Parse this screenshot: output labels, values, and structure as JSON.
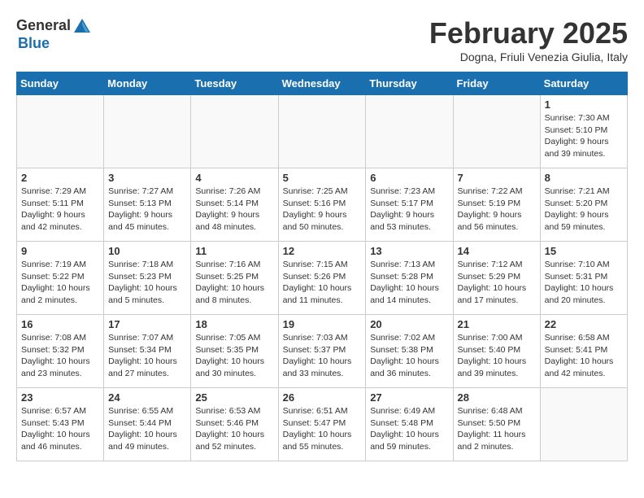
{
  "header": {
    "logo_general": "General",
    "logo_blue": "Blue",
    "title": "February 2025",
    "subtitle": "Dogna, Friuli Venezia Giulia, Italy"
  },
  "calendar": {
    "days_of_week": [
      "Sunday",
      "Monday",
      "Tuesday",
      "Wednesday",
      "Thursday",
      "Friday",
      "Saturday"
    ],
    "weeks": [
      [
        {
          "day": "",
          "info": ""
        },
        {
          "day": "",
          "info": ""
        },
        {
          "day": "",
          "info": ""
        },
        {
          "day": "",
          "info": ""
        },
        {
          "day": "",
          "info": ""
        },
        {
          "day": "",
          "info": ""
        },
        {
          "day": "1",
          "info": "Sunrise: 7:30 AM\nSunset: 5:10 PM\nDaylight: 9 hours and 39 minutes."
        }
      ],
      [
        {
          "day": "2",
          "info": "Sunrise: 7:29 AM\nSunset: 5:11 PM\nDaylight: 9 hours and 42 minutes."
        },
        {
          "day": "3",
          "info": "Sunrise: 7:27 AM\nSunset: 5:13 PM\nDaylight: 9 hours and 45 minutes."
        },
        {
          "day": "4",
          "info": "Sunrise: 7:26 AM\nSunset: 5:14 PM\nDaylight: 9 hours and 48 minutes."
        },
        {
          "day": "5",
          "info": "Sunrise: 7:25 AM\nSunset: 5:16 PM\nDaylight: 9 hours and 50 minutes."
        },
        {
          "day": "6",
          "info": "Sunrise: 7:23 AM\nSunset: 5:17 PM\nDaylight: 9 hours and 53 minutes."
        },
        {
          "day": "7",
          "info": "Sunrise: 7:22 AM\nSunset: 5:19 PM\nDaylight: 9 hours and 56 minutes."
        },
        {
          "day": "8",
          "info": "Sunrise: 7:21 AM\nSunset: 5:20 PM\nDaylight: 9 hours and 59 minutes."
        }
      ],
      [
        {
          "day": "9",
          "info": "Sunrise: 7:19 AM\nSunset: 5:22 PM\nDaylight: 10 hours and 2 minutes."
        },
        {
          "day": "10",
          "info": "Sunrise: 7:18 AM\nSunset: 5:23 PM\nDaylight: 10 hours and 5 minutes."
        },
        {
          "day": "11",
          "info": "Sunrise: 7:16 AM\nSunset: 5:25 PM\nDaylight: 10 hours and 8 minutes."
        },
        {
          "day": "12",
          "info": "Sunrise: 7:15 AM\nSunset: 5:26 PM\nDaylight: 10 hours and 11 minutes."
        },
        {
          "day": "13",
          "info": "Sunrise: 7:13 AM\nSunset: 5:28 PM\nDaylight: 10 hours and 14 minutes."
        },
        {
          "day": "14",
          "info": "Sunrise: 7:12 AM\nSunset: 5:29 PM\nDaylight: 10 hours and 17 minutes."
        },
        {
          "day": "15",
          "info": "Sunrise: 7:10 AM\nSunset: 5:31 PM\nDaylight: 10 hours and 20 minutes."
        }
      ],
      [
        {
          "day": "16",
          "info": "Sunrise: 7:08 AM\nSunset: 5:32 PM\nDaylight: 10 hours and 23 minutes."
        },
        {
          "day": "17",
          "info": "Sunrise: 7:07 AM\nSunset: 5:34 PM\nDaylight: 10 hours and 27 minutes."
        },
        {
          "day": "18",
          "info": "Sunrise: 7:05 AM\nSunset: 5:35 PM\nDaylight: 10 hours and 30 minutes."
        },
        {
          "day": "19",
          "info": "Sunrise: 7:03 AM\nSunset: 5:37 PM\nDaylight: 10 hours and 33 minutes."
        },
        {
          "day": "20",
          "info": "Sunrise: 7:02 AM\nSunset: 5:38 PM\nDaylight: 10 hours and 36 minutes."
        },
        {
          "day": "21",
          "info": "Sunrise: 7:00 AM\nSunset: 5:40 PM\nDaylight: 10 hours and 39 minutes."
        },
        {
          "day": "22",
          "info": "Sunrise: 6:58 AM\nSunset: 5:41 PM\nDaylight: 10 hours and 42 minutes."
        }
      ],
      [
        {
          "day": "23",
          "info": "Sunrise: 6:57 AM\nSunset: 5:43 PM\nDaylight: 10 hours and 46 minutes."
        },
        {
          "day": "24",
          "info": "Sunrise: 6:55 AM\nSunset: 5:44 PM\nDaylight: 10 hours and 49 minutes."
        },
        {
          "day": "25",
          "info": "Sunrise: 6:53 AM\nSunset: 5:46 PM\nDaylight: 10 hours and 52 minutes."
        },
        {
          "day": "26",
          "info": "Sunrise: 6:51 AM\nSunset: 5:47 PM\nDaylight: 10 hours and 55 minutes."
        },
        {
          "day": "27",
          "info": "Sunrise: 6:49 AM\nSunset: 5:48 PM\nDaylight: 10 hours and 59 minutes."
        },
        {
          "day": "28",
          "info": "Sunrise: 6:48 AM\nSunset: 5:50 PM\nDaylight: 11 hours and 2 minutes."
        },
        {
          "day": "",
          "info": ""
        }
      ]
    ]
  }
}
